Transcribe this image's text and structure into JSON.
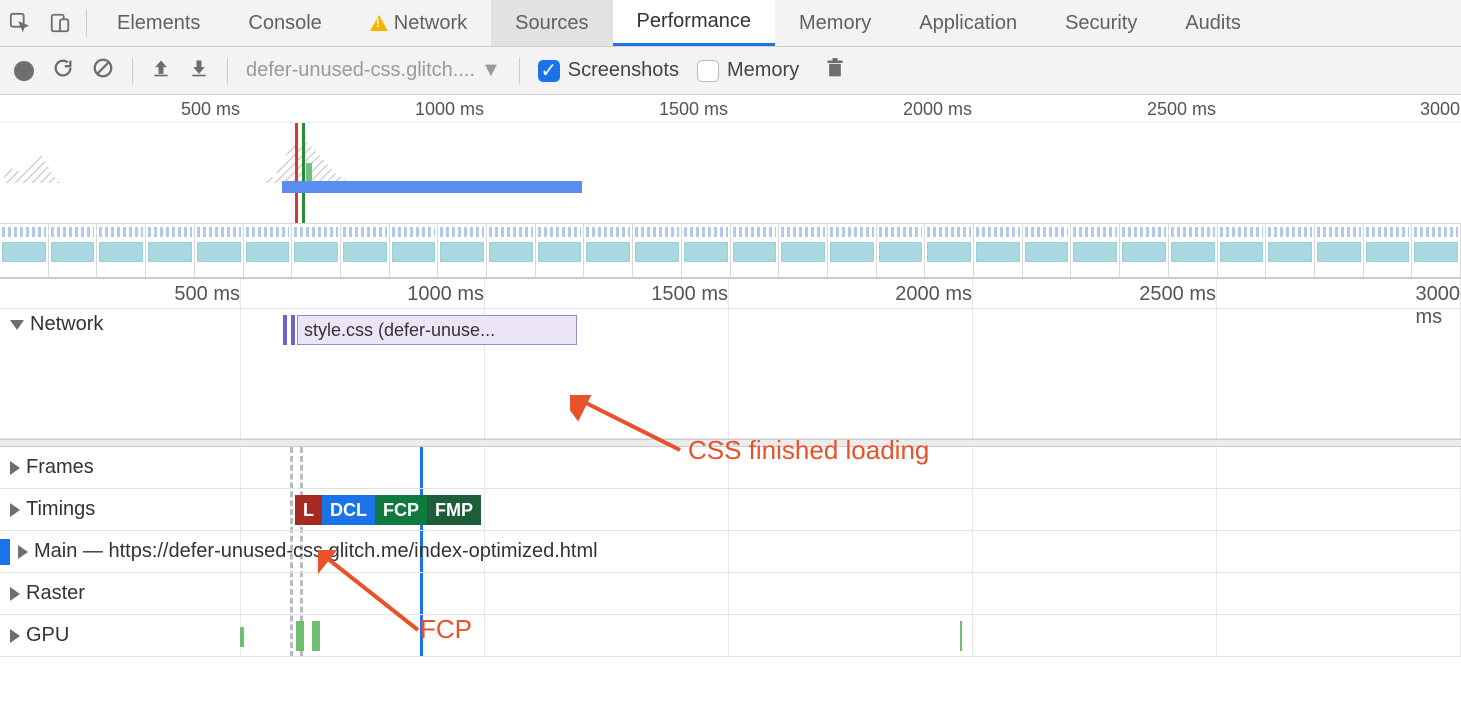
{
  "tabs": {
    "elements": "Elements",
    "console": "Console",
    "network": "Network",
    "sources": "Sources",
    "performance": "Performance",
    "memory": "Memory",
    "application": "Application",
    "security": "Security",
    "audits": "Audits"
  },
  "toolbar": {
    "recording_select": "defer-unused-css.glitch....",
    "screenshots_label": "Screenshots",
    "memory_label": "Memory"
  },
  "overview": {
    "ticks": [
      "500 ms",
      "1000 ms",
      "1500 ms",
      "2000 ms",
      "2500 ms",
      "3000"
    ],
    "tick_right": "3000"
  },
  "detail": {
    "ticks": [
      "500 ms",
      "1000 ms",
      "1500 ms",
      "2000 ms",
      "2500 ms",
      "3000 ms"
    ],
    "tracks": {
      "network": "Network",
      "network_item": "style.css (defer-unuse...",
      "frames": "Frames",
      "timings": "Timings",
      "timing_badges": {
        "l": "L",
        "dcl": "DCL",
        "fcp": "FCP",
        "fmp": "FMP"
      },
      "main": "Main — https://defer-unused-css.glitch.me/index-optimized.html",
      "raster": "Raster",
      "gpu": "GPU"
    }
  },
  "annotations": {
    "css_loaded": "CSS finished loading",
    "fcp": "FCP"
  }
}
